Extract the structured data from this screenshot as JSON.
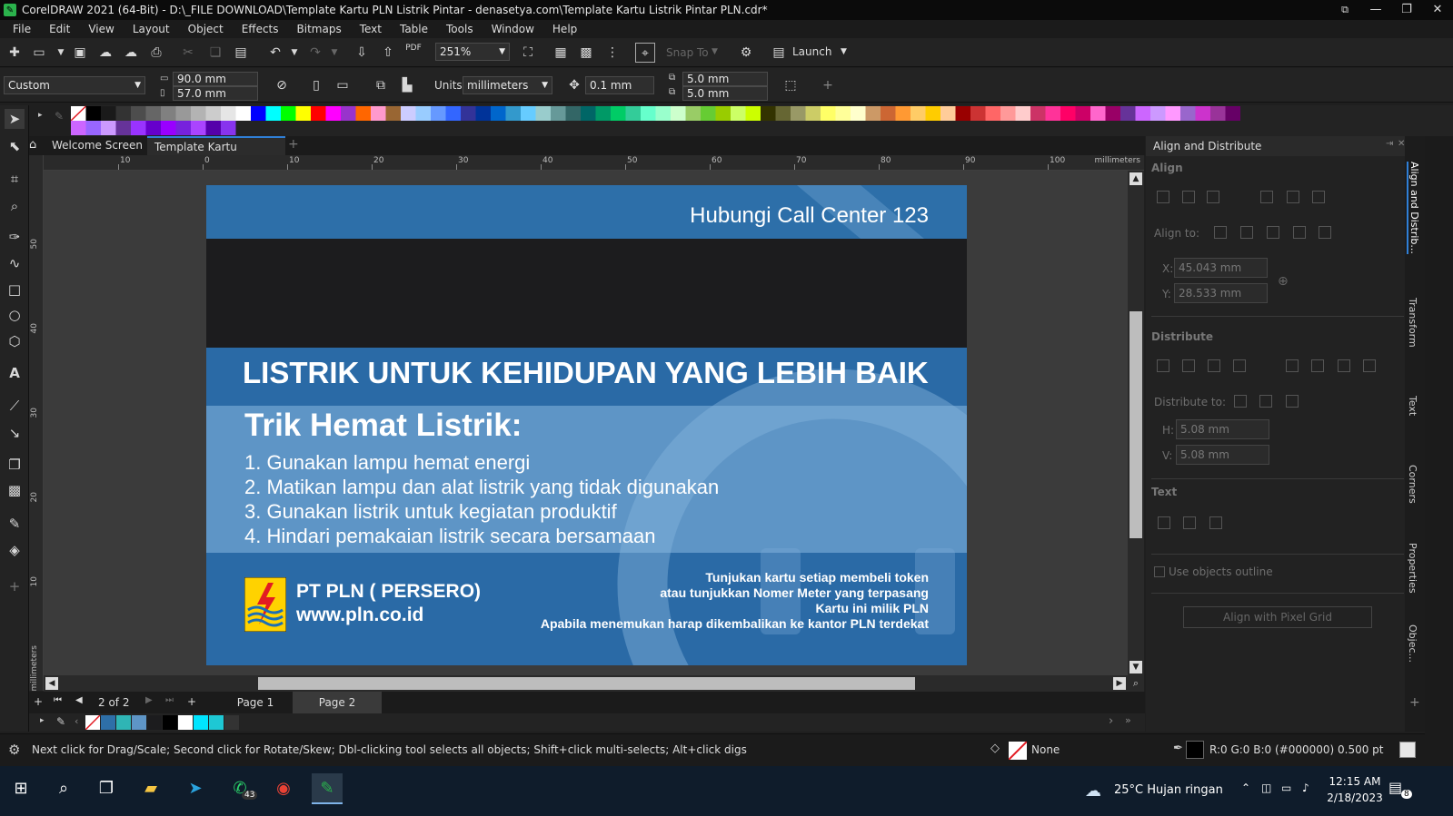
{
  "app": {
    "title": "CorelDRAW 2021 (64-Bit) - D:\\_FILE DOWNLOAD\\Template Kartu PLN Listrik Pintar - denasetya.com\\Template Kartu Listrik Pintar PLN.cdr*"
  },
  "menu": [
    "File",
    "Edit",
    "View",
    "Layout",
    "Object",
    "Effects",
    "Bitmaps",
    "Text",
    "Table",
    "Tools",
    "Window",
    "Help"
  ],
  "toolbar": {
    "zoom": "251%",
    "snap_to": "Snap To",
    "launch": "Launch",
    "pdf": "PDF"
  },
  "propbar": {
    "preset": "Custom",
    "width": "90.0 mm",
    "height": "57.0 mm",
    "units_label": "Units:",
    "units": "millimeters",
    "nudge": "0.1 mm",
    "dup_x": "5.0 mm",
    "dup_y": "5.0 mm"
  },
  "tabs": {
    "welcome": "Welcome Screen",
    "doc": "Template Kartu Listri..*"
  },
  "ruler": {
    "h_labels": [
      "10",
      "0",
      "10",
      "20",
      "30",
      "40",
      "50",
      "60",
      "70",
      "80",
      "90",
      "100"
    ],
    "unit": "millimeters",
    "v_labels": [
      "50",
      "40",
      "30",
      "20",
      "10"
    ]
  },
  "card": {
    "call_center": "Hubungi Call Center 123",
    "headline": "LISTRIK UNTUK KEHIDUPAN YANG LEBIH BAIK",
    "tips_title": "Trik Hemat Listrik:",
    "tips": [
      "1. Gunakan lampu hemat energi",
      "2. Matikan lampu dan alat listrik yang tidak digunakan",
      "3. Gunakan listrik untuk kegiatan produktif",
      "4. Hindari pemakaian listrik secara bersamaan"
    ],
    "company": "PT PLN ( PERSERO)",
    "website": "www.pln.co.id",
    "notes": [
      "Tunjukan kartu setiap membeli token",
      "atau tunjukkan Nomer Meter yang terpasang",
      "Kartu ini milik PLN",
      "Apabila menemukan harap dikembalikan ke kantor PLN terdekat"
    ]
  },
  "pages": {
    "counter": "2  of  2",
    "page1": "Page 1",
    "page2": "Page 2"
  },
  "panel": {
    "title": "Align and Distribute",
    "align": "Align",
    "align_to": "Align to:",
    "x_label": "X:",
    "x_value": "45.043 mm",
    "y_label": "Y:",
    "y_value": "28.533 mm",
    "distribute": "Distribute",
    "distribute_to": "Distribute to:",
    "h_label": "H:",
    "h_value": "5.08 mm",
    "v_label": "V:",
    "v_value": "5.08 mm",
    "text": "Text",
    "use_outline": "Use objects outline",
    "pixel_grid": "Align with Pixel Grid"
  },
  "side_tabs": [
    "Align and Distrib...",
    "Transform",
    "Text",
    "Corners",
    "Properties",
    "Objec..."
  ],
  "status": {
    "hint": "Next click for Drag/Scale; Second click for Rotate/Skew; Dbl-clicking tool selects all objects; Shift+click multi-selects; Alt+click digs",
    "fill": "None",
    "outline": "R:0 G:0 B:0 (#000000)  0.500 pt"
  },
  "taskbar": {
    "weather": "25°C  Hujan ringan",
    "time": "12:15 AM",
    "date": "2/18/2023",
    "whatsapp_badge": "43",
    "notif_badge": "8"
  },
  "colors": {
    "card_blue": "#2e6fa8",
    "card_dark": "#1c1c1e",
    "band_blue": "#2a6aa6",
    "accent_green": "#2bb24c",
    "logo_yellow": "#ffd200"
  }
}
